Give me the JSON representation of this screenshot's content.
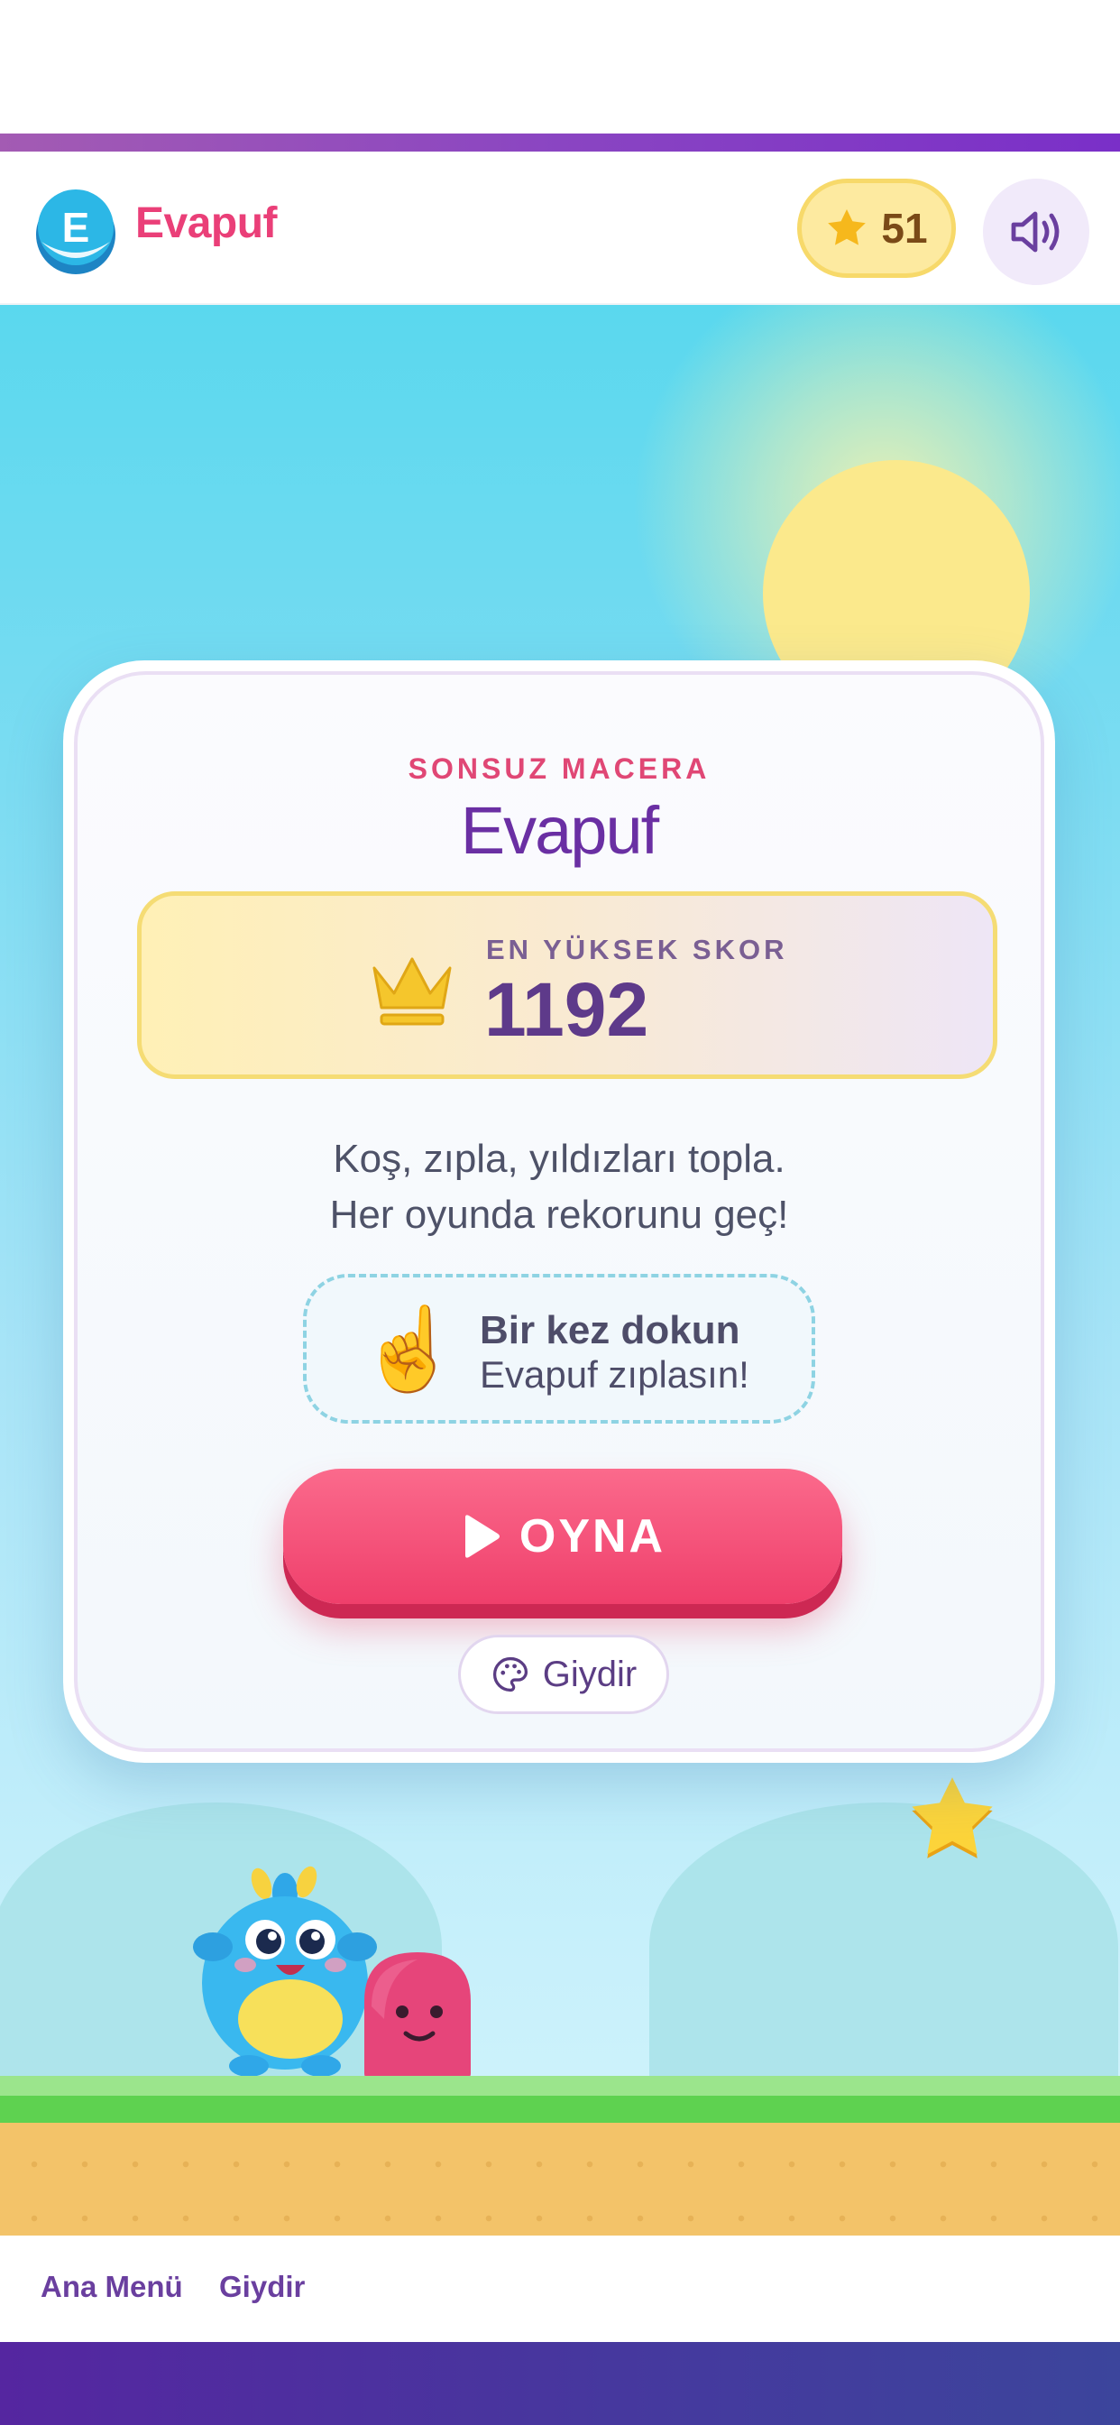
{
  "header": {
    "logo_letter": "E",
    "app_name": "Evapuf",
    "coins": "51",
    "coin_icon": "star-icon",
    "sound_icon": "speaker-icon"
  },
  "card": {
    "subtitle": "SONSUZ MACERA",
    "title": "Evapuf",
    "high_score_label": "EN YÜKSEK SKOR",
    "high_score": "1192",
    "description_line1": "Koş, zıpla, yıldızları topla.",
    "description_line2": "Her oyunda rekorunu geç!",
    "hint_title": "Bir kez dokun",
    "hint_subtitle": "Evapuf zıplasın!",
    "hint_icon": "☝️",
    "play_label": "OYNA",
    "dress_label": "Giydir"
  },
  "nav": {
    "home": "Ana Menü",
    "dress": "Giydir"
  },
  "colors": {
    "accent_pink": "#ea3f78",
    "accent_purple": "#6a2fa3",
    "play_button": "#ef3f6b",
    "sky": "#5ad8ee",
    "grass": "#5ed250"
  }
}
